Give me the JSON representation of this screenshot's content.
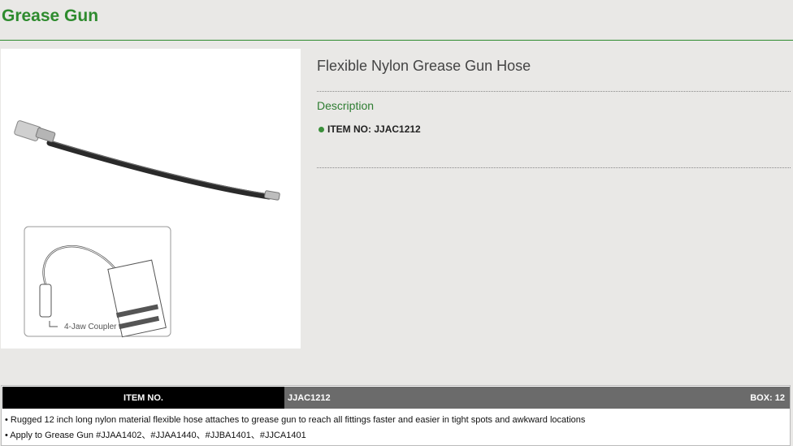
{
  "page": {
    "title": "Grease Gun"
  },
  "product": {
    "name": "Flexible Nylon Grease Gun Hose",
    "description_label": "Description",
    "item_no_label": "ITEM NO:",
    "item_no": "JJAC1212"
  },
  "image": {
    "callout": "4-Jaw Coupler"
  },
  "spec_table": {
    "header_label": "ITEM NO.",
    "item_no": "JJAC1212",
    "box": "BOX: 12",
    "notes": [
      "• Rugged 12 inch long nylon material flexible hose attaches to grease gun to reach all fittings faster and easier in tight spots and awkward locations",
      "• Apply to Grease Gun #JJAA1402、#JJAA1440、#JJBA1401、#JJCA1401"
    ]
  },
  "colors": {
    "accent": "#2e8b2e",
    "header_dark": "#000000",
    "header_gray": "#6b6b6b"
  }
}
